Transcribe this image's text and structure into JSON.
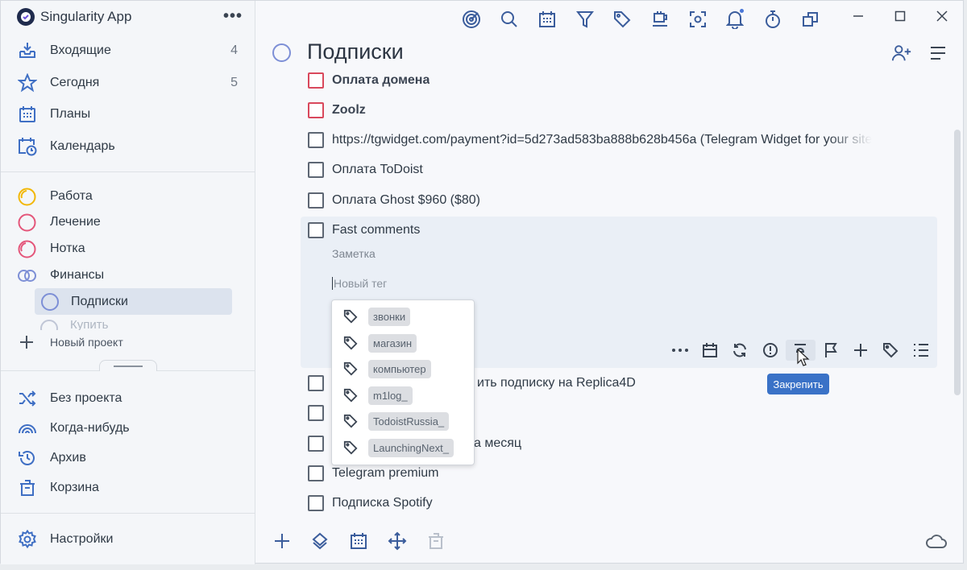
{
  "app": {
    "title": "Singularity App",
    "menu": "•••"
  },
  "sidebar": {
    "nav": [
      {
        "label": "Входящие",
        "count": "4",
        "icon": "inbox-icon"
      },
      {
        "label": "Сегодня",
        "count": "5",
        "icon": "star-icon"
      },
      {
        "label": "Планы",
        "count": "",
        "icon": "calendar-grid-icon"
      },
      {
        "label": "Календарь",
        "count": "",
        "icon": "calendar-clock-icon"
      }
    ],
    "projects": [
      {
        "label": "Работа",
        "color": "#f2b705"
      },
      {
        "label": "Лечение",
        "color": "#e4567a"
      },
      {
        "label": "Нотка",
        "color": "#e4567a"
      },
      {
        "label": "Финансы",
        "color": "#7d8fd6"
      }
    ],
    "sub_project": "Подписки",
    "sub_project_ghost": "Купить",
    "new_project": "Новый проект",
    "bottom_nav": [
      {
        "label": "Без проекта",
        "icon": "shuffle-icon"
      },
      {
        "label": "Когда-нибудь",
        "icon": "rainbow-icon"
      },
      {
        "label": "Архив",
        "icon": "history-icon"
      },
      {
        "label": "Корзина",
        "icon": "trash-icon"
      }
    ],
    "settings": "Настройки"
  },
  "main": {
    "title": "Подписки",
    "tasks": [
      {
        "text": "Оплата домена",
        "bold": true,
        "priority": "high"
      },
      {
        "text": "Zoolz",
        "bold": true,
        "priority": "high"
      },
      {
        "text": "https://tgwidget.com/payment?id=5d273ad583ba888b628b456a (Telegram Widget for your site",
        "bold": false
      },
      {
        "text": "Оплата ToDoist",
        "bold": false
      },
      {
        "text": "Оплата Ghost $960 ($80)",
        "bold": false
      },
      {
        "text": "Fast comments",
        "bold": false
      }
    ],
    "expanded": {
      "note_placeholder": "Заметка",
      "tag_placeholder": "Новый тег"
    },
    "tasks_below": [
      {
        "text": "ить подписку на Replica4D"
      },
      {
        "text": ""
      },
      {
        "text": "а месяц"
      },
      {
        "text": "Telegram premium"
      },
      {
        "text": "Подписка Spotify"
      }
    ],
    "tags": [
      "звонки",
      "магазин",
      "компьютер",
      "m1log_",
      "TodoistRussia_",
      "LaunchingNext_"
    ],
    "tooltip": "Закрепить"
  },
  "colors": {
    "accent": "#3a72c7",
    "priority": "#d9485c",
    "project_circle": "#7d8fd6"
  }
}
